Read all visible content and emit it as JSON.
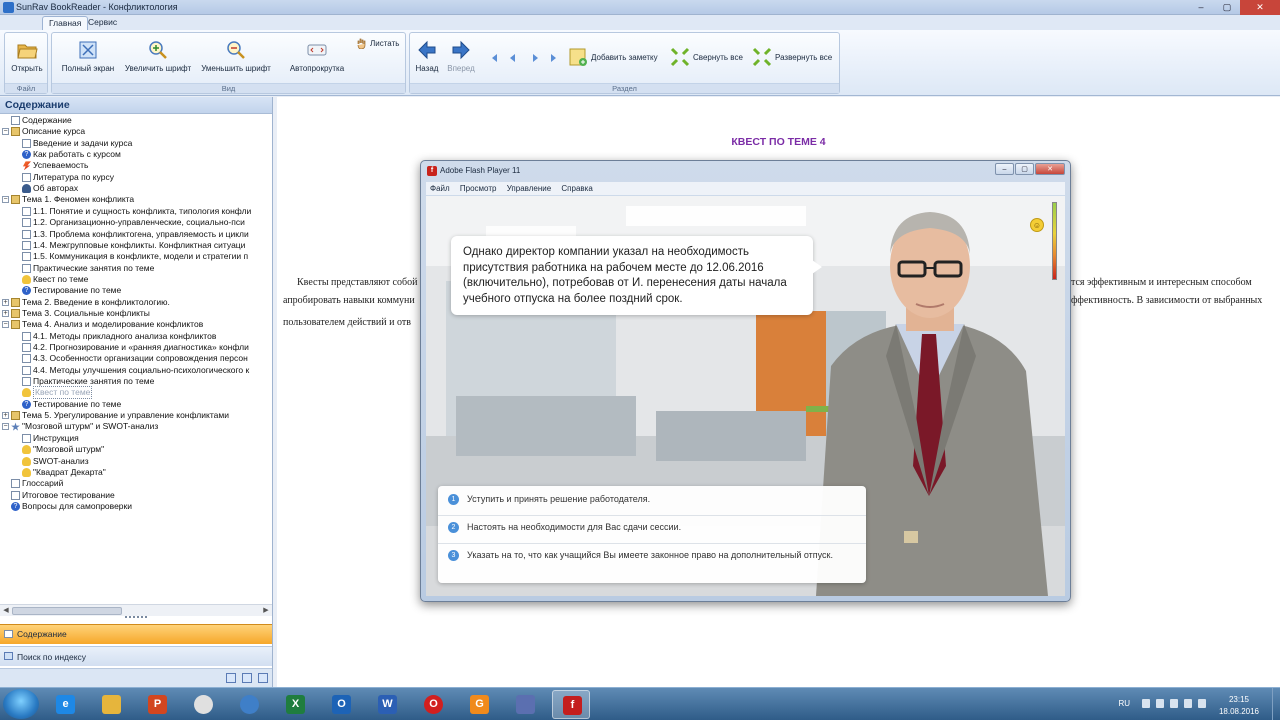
{
  "window": {
    "title": "SunRav BookReader  -  Конфликтология",
    "buttons": [
      "–",
      "▢",
      "✕"
    ]
  },
  "ribbon": {
    "tabs": [
      "Главная",
      "Сервис"
    ],
    "groups": {
      "file": "Файл",
      "view": "Вид",
      "section": "Раздел"
    },
    "buttons": {
      "open": "Открыть",
      "fullscreen": "Полный экран",
      "zoom_in": "Увеличить шрифт",
      "zoom_out": "Уменьшить шрифт",
      "autoscroll": "Автопрокрутка",
      "flip": "Листать",
      "back": "Назад",
      "forward": "Вперед",
      "add_note": "Добавить заметку",
      "collapse_all": "Свернуть все",
      "expand_all": "Развернуть все"
    }
  },
  "sidebar": {
    "title": "Содержание",
    "tree": [
      {
        "label": "Содержание",
        "icon": "page"
      },
      {
        "label": "Описание курса",
        "icon": "book",
        "toggle": "−"
      },
      {
        "label": "Введение и задачи курса",
        "icon": "page"
      },
      {
        "label": "Как работать с курсом",
        "icon": "help"
      },
      {
        "label": "Успеваемость",
        "icon": "bolt"
      },
      {
        "label": "Литература по курсу",
        "icon": "page"
      },
      {
        "label": "Об авторах",
        "icon": "man"
      },
      {
        "label": "Тема 1. Феномен конфликта",
        "icon": "book",
        "toggle": "−"
      },
      {
        "label": "1.1. Понятие и сущность конфликта, типология конфли",
        "icon": "page"
      },
      {
        "label": "1.2. Организационно-управленческие, социально-пси",
        "icon": "page"
      },
      {
        "label": "1.3. Проблема конфликтогена, управляемость и цикли",
        "icon": "page"
      },
      {
        "label": "1.4. Межгрупповые конфликты. Конфликтная ситуаци",
        "icon": "page"
      },
      {
        "label": "1.5. Коммуникация в конфликте, модели и стратегии п",
        "icon": "page"
      },
      {
        "label": "Практические занятия по теме",
        "icon": "page"
      },
      {
        "label": "Квест по теме",
        "icon": "bulb"
      },
      {
        "label": "Тестирование по теме",
        "icon": "help"
      },
      {
        "label": "Тема 2. Введение в конфликтологию.",
        "icon": "book",
        "toggle": "+"
      },
      {
        "label": "Тема 3. Социальные конфликты",
        "icon": "book",
        "toggle": "+"
      },
      {
        "label": "Тема 4. Анализ и моделирование конфликтов",
        "icon": "book",
        "toggle": "−"
      },
      {
        "label": "4.1. Методы прикладного анализа конфликтов",
        "icon": "page"
      },
      {
        "label": "4.2. Прогнозирование и «ранняя диагностика» конфли",
        "icon": "page"
      },
      {
        "label": "4.3. Особенности организации сопровождения персон",
        "icon": "page"
      },
      {
        "label": "4.4. Методы улучшения социально-психологического к",
        "icon": "page"
      },
      {
        "label": "Практические занятия по теме",
        "icon": "page"
      },
      {
        "label": "Квест по теме",
        "icon": "bulb",
        "selected": true
      },
      {
        "label": "Тестирование по теме",
        "icon": "help"
      },
      {
        "label": "Тема 5. Урегулирование и управление конфликтами",
        "icon": "book",
        "toggle": "+"
      },
      {
        "label": "\"Мозговой штурм\" и SWOT-анализ",
        "icon": "star",
        "toggle": "−"
      },
      {
        "label": "Инструкция",
        "icon": "page"
      },
      {
        "label": "\"Мозговой штурм\"",
        "icon": "bulb"
      },
      {
        "label": "SWOT-анализ",
        "icon": "bulb"
      },
      {
        "label": "\"Квадрат Декарта\"",
        "icon": "bulb"
      },
      {
        "label": "Глоссарий",
        "icon": "page"
      },
      {
        "label": "Итоговое тестирование",
        "icon": "page"
      },
      {
        "label": "Вопросы для самопроверки",
        "icon": "help"
      }
    ],
    "nav_content": "Содержание",
    "nav_index": "Поиск по индексу"
  },
  "content": {
    "heading": "КВЕСТ ПО ТЕМЕ 4",
    "left_lines": [
      "Квесты представляют собой",
      "апробировать навыки коммуни",
      "пользователем действий и отв"
    ],
    "right_lines": [
      "тся эффективным и интересным способом",
      "ффективность. В зависимости от выбранных"
    ]
  },
  "flash": {
    "title": "Adobe Flash Player 11",
    "menu": [
      "Файл",
      "Просмотр",
      "Управление",
      "Справка"
    ],
    "speech": "Однако директор компании указал на необходимость присутствия работника на рабочем месте до 12.06.2016 (включительно), потребовав от И. перенесения даты начала учебного отпуска на более поздний срок.",
    "answers": [
      {
        "num": "1",
        "text": "Уступить и принять решение работодателя."
      },
      {
        "num": "2",
        "text": "Настоять на необходимости для Вас сдачи сессии."
      },
      {
        "num": "3",
        "text": "Указать на то, что как учащийся Вы имеете законное право на дополнительный отпуск."
      }
    ]
  },
  "taskbar": {
    "apps": [
      "ie-icon",
      "folder-icon",
      "powerpoint-icon",
      "chrome-icon",
      "messenger-icon",
      "excel-icon",
      "outlook-icon",
      "word-icon",
      "opera-icon",
      "app-orange-icon",
      "mediaplayer-icon",
      "flash-icon"
    ],
    "lang": "RU",
    "time": "23:15",
    "date": "18.08.2016"
  },
  "colors": {
    "accent_purple": "#7b2ca6",
    "nav_active": "#f6a72a",
    "ribbon_blue": "#dde8f6"
  }
}
